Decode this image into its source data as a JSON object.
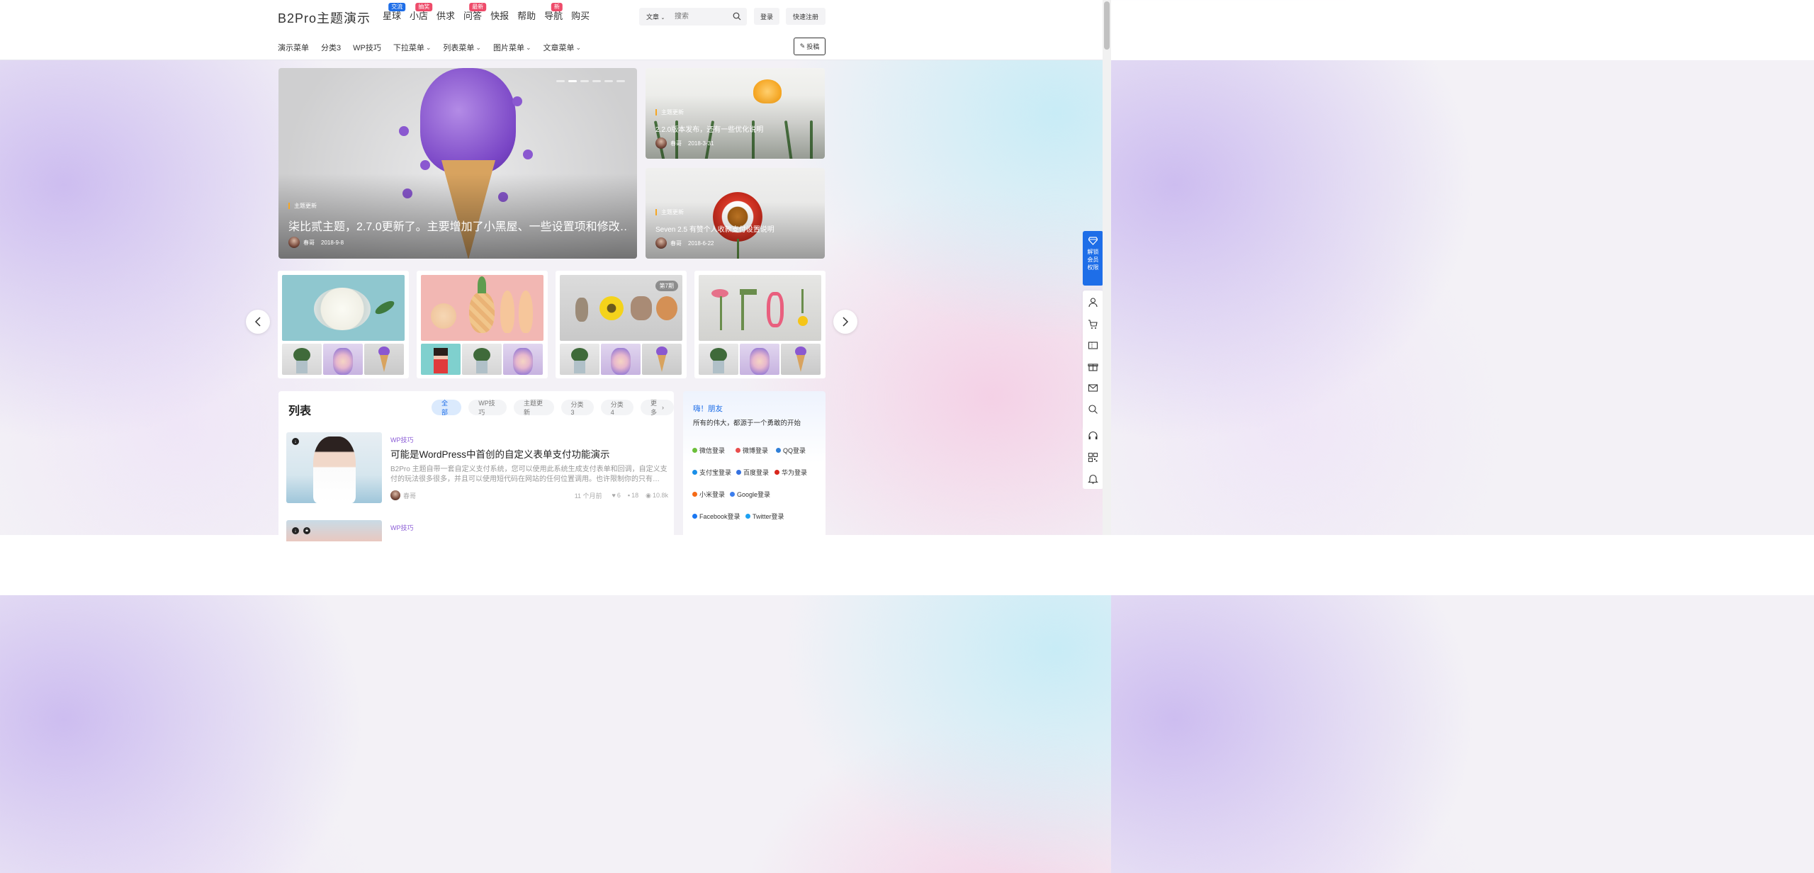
{
  "header": {
    "logo": "B2Pro主题演示",
    "nav": [
      {
        "label": "星球",
        "badge": "交流",
        "badge_color": "#1e6ee8"
      },
      {
        "label": "小店",
        "badge": "抽奖",
        "badge_color": "#ee4b6a"
      },
      {
        "label": "供求",
        "badge": "",
        "badge_color": ""
      },
      {
        "label": "问答",
        "badge": "最新",
        "badge_color": "#ee4b6a"
      },
      {
        "label": "快报",
        "badge": "",
        "badge_color": ""
      },
      {
        "label": "帮助",
        "badge": "",
        "badge_color": ""
      },
      {
        "label": "导航",
        "badge": "新",
        "badge_color": "#ee4b6a"
      },
      {
        "label": "购买",
        "badge": "",
        "badge_color": ""
      }
    ],
    "search_type": "文章",
    "search_placeholder": "搜索",
    "login": "登录",
    "register": "快速注册"
  },
  "subnav": {
    "items": [
      {
        "label": "演示菜单",
        "dropdown": false
      },
      {
        "label": "分类3",
        "dropdown": false
      },
      {
        "label": "WP技巧",
        "dropdown": false
      },
      {
        "label": "下拉菜单",
        "dropdown": true
      },
      {
        "label": "列表菜单",
        "dropdown": true
      },
      {
        "label": "图片菜单",
        "dropdown": true
      },
      {
        "label": "文章菜单",
        "dropdown": true
      }
    ],
    "post_button": "投稿"
  },
  "hero": {
    "category": "主题更新",
    "title": "柒比贰主题，2.7.0更新了。主要增加了小黑屋、一些设置项和修改…",
    "author": "春哥",
    "date": "2018-9-8"
  },
  "side_cards": [
    {
      "category": "主题更新",
      "title": "2.2.0版本发布，还有一些优化说明",
      "author": "春哥",
      "date": "2018-3-31"
    },
    {
      "category": "主题更新",
      "title": "Seven 2.5 有赞个人收款支付设置说明",
      "author": "春哥",
      "date": "2018-6-22"
    }
  ],
  "collection": {
    "badge": "第7期"
  },
  "list": {
    "title": "列表",
    "tabs": [
      "全部",
      "WP技巧",
      "主题更新",
      "分类3",
      "分类4",
      "更多"
    ],
    "active_tab": "全部",
    "items": [
      {
        "category": "WP技巧",
        "title": "可能是WordPress中首创的自定义表单支付功能演示",
        "desc": "B2Pro 主题自带一套自定义支付系统，您可以使用此系统生成支付表单和回调，自定义支付的玩法很多很多，并且可以使用短代码在网站的任何位置调用。也许限制你的只有…",
        "author": "春哥",
        "time": "11 个月前",
        "likes": "6",
        "comments": "18",
        "views": "10.8k"
      }
    ],
    "next_category": "WP技巧"
  },
  "welcome": {
    "title": "嗨！朋友",
    "subtitle": "所有的伟大，都源于一个勇敢的开始",
    "logins": [
      {
        "label": "微信登录",
        "color": "#6bbf3a"
      },
      {
        "label": "微博登录",
        "color": "#e94d4d"
      },
      {
        "label": "QQ登录",
        "color": "#2f7fd8"
      },
      {
        "label": "支付宝登录",
        "color": "#1a8fe8"
      },
      {
        "label": "百度登录",
        "color": "#3571e0"
      },
      {
        "label": "华为登录",
        "color": "#d8261c"
      },
      {
        "label": "小米登录",
        "color": "#f56a16"
      },
      {
        "label": "Google登录",
        "color": "#3b7ded"
      },
      {
        "label": "Facebook登录",
        "color": "#1a77f2"
      },
      {
        "label": "Twitter登录",
        "color": "#1da1f2"
      }
    ]
  },
  "sidebar": {
    "vip": "解锁会员权限",
    "icons": [
      "user-icon",
      "cart-icon",
      "ticket-icon",
      "gift-icon",
      "message-icon",
      "search-icon",
      "support-icon",
      "qrcode-icon",
      "bell-icon"
    ]
  }
}
